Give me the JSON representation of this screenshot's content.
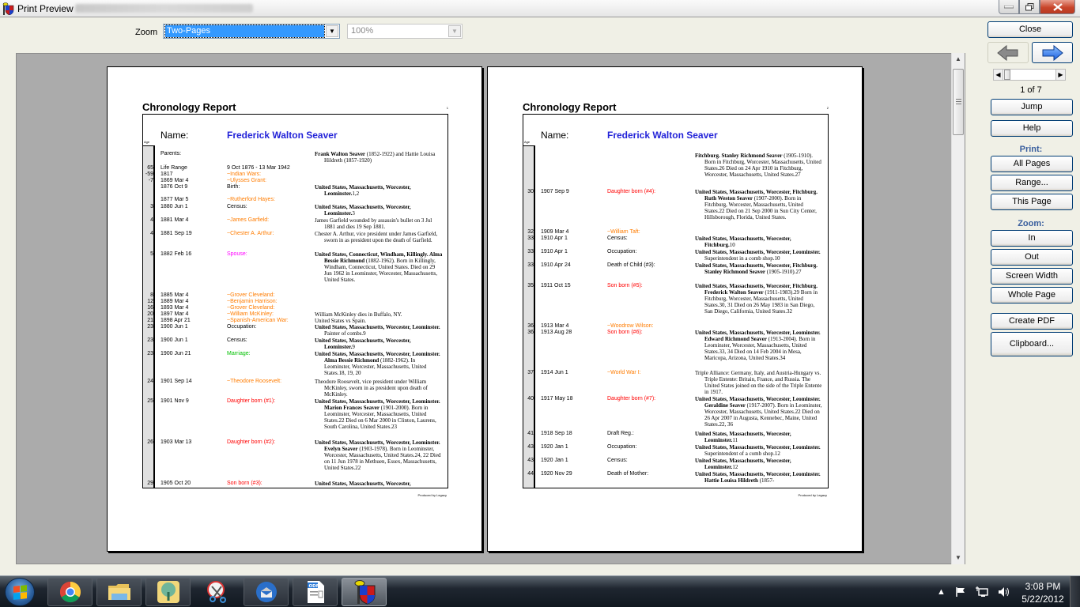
{
  "window": {
    "title": "Print Preview",
    "controls": {
      "minimize": "minimize",
      "maximize": "restore",
      "close": "close"
    }
  },
  "toolbar": {
    "zoom_label": "Zoom",
    "zoom_mode": "Two-Pages",
    "zoom_percent": "100%"
  },
  "report": {
    "title": "Chronology Report",
    "name_label": "Name:",
    "name_value": "Frederick Walton  Seaver",
    "age_header": "Age",
    "footer": "Produced by Legacy",
    "colors": {
      "name": "#2323d8",
      "history": "#ff7c00",
      "child": "#ff0000",
      "spouse": "#ff00ff",
      "marriage": "#00c000"
    }
  },
  "pages": [
    {
      "page_number": "1",
      "rows": [
        {
          "age": "",
          "date": "Parents:",
          "event": "",
          "color": "",
          "detail_bold": "Frank Walton Seaver",
          "detail": " (1852-1922) and Hattie Louisa Hildreth (1857-1920)"
        },
        {
          "age": "65",
          "date": "Life Range",
          "event": "9 Oct 1876 - 13 Mar 1942",
          "color": "",
          "detail_bold": "",
          "detail": ""
        },
        {
          "age": "-59",
          "date": "1817",
          "event": "~Indian Wars:",
          "color": "orange",
          "detail_bold": "",
          "detail": ""
        },
        {
          "age": "-7",
          "date": "1869 Mar 4",
          "event": "~Ulysses Grant:",
          "color": "orange",
          "detail_bold": "",
          "detail": ""
        },
        {
          "age": "",
          "date": "1876 Oct 9",
          "event": "Birth:",
          "color": "",
          "detail_bold": "United States, Massachusetts, Worcester, Leominster.",
          "detail": "1,2"
        },
        {
          "age": "",
          "date": "1877 Mar 5",
          "event": "~Rutherford Hayes:",
          "color": "orange",
          "detail_bold": "",
          "detail": ""
        },
        {
          "age": "3",
          "date": "1880 Jun 1",
          "event": "Census:",
          "color": "",
          "detail_bold": "United States, Massachusetts, Worcester, Leominster.",
          "detail": "3"
        },
        {
          "age": "4",
          "date": "1881 Mar 4",
          "event": "~James Garfield:",
          "color": "orange",
          "detail_bold": "",
          "detail": "James Garfield wounded by assassin's bullet on 3 Jul 1881 and dies 19 Sep 1881."
        },
        {
          "age": "4",
          "date": "1881 Sep 19",
          "event": "~Chester A. Arthur:",
          "color": "orange",
          "detail_bold": "",
          "detail": "Chester A. Arthur, vice president under James Garfield, sworn in as president upon the death of Garfield."
        },
        {
          "age": "5",
          "date": "1882 Feb 16",
          "event": "Spouse:",
          "color": "magenta",
          "detail_bold": "United States, Connecticut, Windham, Killingly.  Alma Bessie Richmond",
          "detail": " (1882-1962). Born in Killingly, Windham, Connecticut, United States.  Died on 29 Jun 1962 in Leominster, Worcester, Massachusetts, United States."
        },
        {
          "age": "8",
          "date": "1885 Mar 4",
          "event": "~Grover Cleveland:",
          "color": "orange",
          "detail_bold": "",
          "detail": ""
        },
        {
          "age": "12",
          "date": "1889 Mar 4",
          "event": "~Benjamin Harrison:",
          "color": "orange",
          "detail_bold": "",
          "detail": ""
        },
        {
          "age": "16",
          "date": "1893 Mar 4",
          "event": "~Grover Cleveland:",
          "color": "orange",
          "detail_bold": "",
          "detail": ""
        },
        {
          "age": "20",
          "date": "1897 Mar 4",
          "event": "~William McKinley:",
          "color": "orange",
          "detail_bold": "",
          "detail": "William McKinley dies in Buffalo, NY."
        },
        {
          "age": "21",
          "date": "1898 Apr 21",
          "event": "~Spanish-American War:",
          "color": "orange",
          "detail_bold": "",
          "detail": "United States vs Spain."
        },
        {
          "age": "23",
          "date": "1900 Jun 1",
          "event": "Occupation:",
          "color": "",
          "detail_bold": "United States, Massachusetts, Worcester, Leominster.",
          "detail": "  Painter of combs.9"
        },
        {
          "age": "23",
          "date": "1900 Jun 1",
          "event": "Census:",
          "color": "",
          "detail_bold": "United States, Massachusetts, Worcester, Leominster.",
          "detail": "9"
        },
        {
          "age": "23",
          "date": "1900 Jun 21",
          "event": "Marriage:",
          "color": "green",
          "detail_bold": "United States, Massachusetts, Worcester, Leominster.  Alma Bessie Richmond",
          "detail": " (1882-1962).  In Leominster, Worcester, Massachusetts, United States.18, 19, 20"
        },
        {
          "age": "24",
          "date": "1901 Sep 14",
          "event": "~Theodore Roosevelt:",
          "color": "orange",
          "detail_bold": "",
          "detail": "Theodore Roosevelt, vice president under William McKinley, sworn in as president upon death of McKinley."
        },
        {
          "age": "25",
          "date": "1901 Nov 9",
          "event": "Daughter born (#1):",
          "color": "red",
          "detail_bold": "United States, Massachusetts, Worcester, Leominster.  Marion Frances Seaver",
          "detail": " (1901-2000).  Born in Leominster, Worcester, Massachusetts, United States.22  Died on 6 Mar 2000 in Clinton, Laurens, South Carolina, United States.23"
        },
        {
          "age": "26",
          "date": "1903 Mar 13",
          "event": "Daughter born (#2):",
          "color": "red",
          "detail_bold": "United States, Massachusetts, Worcester, Leominster.  Evelyn Seaver",
          "detail": " (1903-1978).  Born in Leominster, Worcester, Massachusetts, United States.24, 22  Died on 11 Jun 1978 in Methuen, Essex, Massachusetts, United States.22"
        },
        {
          "age": "29",
          "date": "1905 Oct 20",
          "event": "Son born (#3):",
          "color": "red",
          "detail_bold": "United States, Massachusetts, Worcester,",
          "detail": ""
        }
      ]
    },
    {
      "page_number": "2",
      "rows": [
        {
          "age": "",
          "date": "",
          "event": "",
          "color": "",
          "detail_bold": "Fitchburg.  Stanley Richmond Seaver",
          "detail": " (1905-1910).  Born in Fitchburg, Worcester, Massachusetts, United States.26  Died on 24 Apr 1910 in Fitchburg, Worcester, Massachusetts, United States.27"
        },
        {
          "age": "30",
          "date": "1907 Sep 9",
          "event": "Daughter born (#4):",
          "color": "red",
          "detail_bold": "United States, Massachusetts, Worcester, Fitchburg.  Ruth Weston Seaver",
          "detail": " (1907-2000).  Born in Fitchburg, Worcester, Massachusetts, United States.22  Died on 21 Sep 2000 in Sun City Center, Hillsborough, Florida, United States."
        },
        {
          "age": "32",
          "date": "1909 Mar 4",
          "event": "~William Taft:",
          "color": "orange",
          "detail_bold": "",
          "detail": ""
        },
        {
          "age": "33",
          "date": "1910 Apr 1",
          "event": "Census:",
          "color": "",
          "detail_bold": "United States, Massachusetts, Worcester, Fitchburg.",
          "detail": "10"
        },
        {
          "age": "33",
          "date": "1910 Apr 1",
          "event": "Occupation:",
          "color": "",
          "detail_bold": "United States, Massachusetts, Worcester, Leominster.",
          "detail": "  Superintendent in a comb shop.10"
        },
        {
          "age": "33",
          "date": "1910 Apr 24",
          "event": "Death of Child (#3):",
          "color": "",
          "detail_bold": "United States, Massachusetts, Worcester, Fitchburg.  Stanley Richmond Seaver",
          "detail": " (1905-1910).27"
        },
        {
          "age": "35",
          "date": "1911 Oct 15",
          "event": "Son born (#5):",
          "color": "red",
          "detail_bold": "United States, Massachusetts, Worcester, Fitchburg.  Frederick Walton Seaver",
          "detail": " (1911-1983).29  Born in Fitchburg, Worcester, Massachusetts, United States.30, 31  Died on 26 May 1983 in San Diego, San Diego, California, United States.32"
        },
        {
          "age": "36",
          "date": "1913 Mar 4",
          "event": "~Woodrow Wilson:",
          "color": "orange",
          "detail_bold": "",
          "detail": ""
        },
        {
          "age": "36",
          "date": "1913 Aug 28",
          "event": "Son born (#6):",
          "color": "red",
          "detail_bold": "United States, Massachusetts, Worcester, Leominster.  Edward Richmond Seaver",
          "detail": " (1913-2004).  Born in Leominster, Worcester, Massachusetts, United States.33, 34  Died on 14 Feb 2004 in Mesa, Maricopa, Arizona, United States.34"
        },
        {
          "age": "37",
          "date": "1914 Jun 1",
          "event": "~World War I:",
          "color": "orange",
          "detail_bold": "",
          "detail": "Triple Alliance: Germany, Italy, and Austria-Hungary vs. Triple Entente: Britain, France, and Russia. The United States joined on the side of the Triple Entente in 1917."
        },
        {
          "age": "40",
          "date": "1917 May 18",
          "event": "Daughter born (#7):",
          "color": "red",
          "detail_bold": "United States, Massachusetts, Worcester, Leominster.  Geraldine Seaver",
          "detail": " (1917-2007).  Born in Leominster, Worcester, Massachusetts, United States.22  Died on 26 Apr 2007 in Augusta, Kennebec, Maine, United States.22, 36"
        },
        {
          "age": "41",
          "date": "1918 Sep 18",
          "event": "Draft Reg.:",
          "color": "",
          "detail_bold": "United States, Massachusetts, Worcester, Leominster.",
          "detail": "11"
        },
        {
          "age": "43",
          "date": "1920 Jan 1",
          "event": "Occupation:",
          "color": "",
          "detail_bold": "United States, Massachusetts, Worcester, Leominster.",
          "detail": "  Superintendent of a comb shop.12"
        },
        {
          "age": "43",
          "date": "1920 Jan 1",
          "event": "Census:",
          "color": "",
          "detail_bold": "United States, Massachusetts, Worcester, Leominster.",
          "detail": "12"
        },
        {
          "age": "44",
          "date": "1920 Nov 29",
          "event": "Death of Mother:",
          "color": "",
          "detail_bold": "United States, Massachusetts, Worcester, Leominster.  Hattie Louisa Hildreth",
          "detail": " (1857-"
        }
      ]
    }
  ],
  "side_panel": {
    "close": "Close",
    "prev_icon": "arrow-left-icon",
    "next_icon": "arrow-right-icon",
    "page_indicator": "1 of 7",
    "current_page": 1,
    "total_pages": 7,
    "jump": "Jump",
    "help": "Help",
    "print_label": "Print:",
    "all_pages": "All Pages",
    "range": "Range...",
    "this_page": "This Page",
    "zoom_label": "Zoom:",
    "zoom_in": "In",
    "zoom_out": "Out",
    "screen_width": "Screen Width",
    "whole_page": "Whole Page",
    "create_pdf": "Create PDF",
    "clipboard": "Clipboard..."
  },
  "taskbar": {
    "items": [
      {
        "name": "chrome",
        "icon": "chrome-icon"
      },
      {
        "name": "explorer",
        "icon": "folder-icon"
      },
      {
        "name": "family-tree",
        "icon": "tree-icon"
      },
      {
        "name": "snipping-tool",
        "icon": "scissors-icon"
      },
      {
        "name": "thunderbird",
        "icon": "mail-icon"
      },
      {
        "name": "odf-document",
        "icon": "odf-icon"
      },
      {
        "name": "legacy-family-tree",
        "icon": "shield-icon",
        "active": true
      }
    ],
    "time": "3:08 PM",
    "date": "5/22/2012"
  }
}
